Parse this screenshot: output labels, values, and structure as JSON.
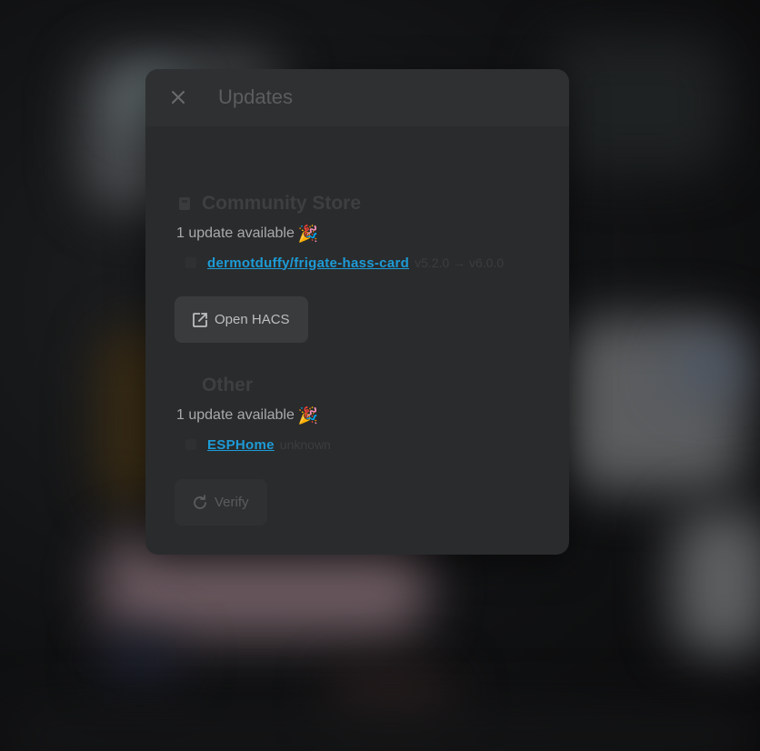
{
  "dialog": {
    "title": "Updates",
    "close_icon": "close-icon"
  },
  "sections": [
    {
      "title": "Community Store",
      "icon": "store-icon",
      "summary": "1 update available",
      "summary_emoji": "🎉",
      "items": [
        {
          "name": "dermotduffy/frigate-hass-card",
          "version": "v5.2.0 → v6.0.0"
        }
      ],
      "button": {
        "label": "Open HACS",
        "icon": "open-in-new-icon",
        "enabled": true
      }
    },
    {
      "title": "Other",
      "icon": "",
      "summary": "1 update available",
      "summary_emoji": "🎉",
      "items": [
        {
          "name": "ESPHome",
          "version": "unknown"
        }
      ],
      "button": {
        "label": "Verify",
        "icon": "refresh-icon",
        "enabled": false
      }
    }
  ],
  "colors": {
    "link": "#1d9bd6",
    "dialog_bg": "#2a2b2c",
    "button_bg": "#3a3b3c"
  }
}
